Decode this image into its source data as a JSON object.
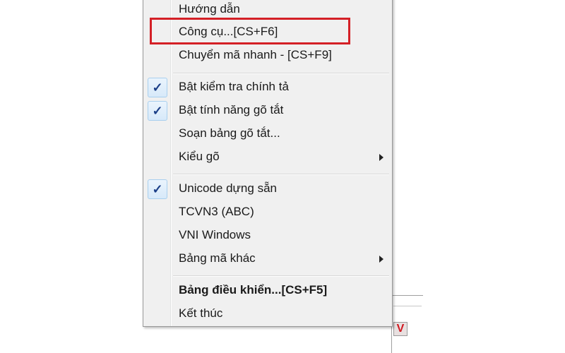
{
  "menu": {
    "items": [
      {
        "label": "Hướng dẫn",
        "checked": false,
        "submenu": false,
        "bold": false
      },
      {
        "label": "Công cụ...[CS+F6]",
        "checked": false,
        "submenu": false,
        "bold": false,
        "highlighted": true
      },
      {
        "label": "Chuyển mã nhanh - [CS+F9]",
        "checked": false,
        "submenu": false,
        "bold": false
      },
      {
        "label": "Bật kiểm tra chính tả",
        "checked": true,
        "submenu": false,
        "bold": false
      },
      {
        "label": "Bật tính năng gõ tắt",
        "checked": true,
        "submenu": false,
        "bold": false
      },
      {
        "label": "Soạn bảng gõ tắt...",
        "checked": false,
        "submenu": false,
        "bold": false
      },
      {
        "label": "Kiểu gõ",
        "checked": false,
        "submenu": true,
        "bold": false
      },
      {
        "label": "Unicode dựng sẵn",
        "checked": true,
        "submenu": false,
        "bold": false
      },
      {
        "label": "TCVN3 (ABC)",
        "checked": false,
        "submenu": false,
        "bold": false
      },
      {
        "label": "VNI Windows",
        "checked": false,
        "submenu": false,
        "bold": false
      },
      {
        "label": "Bảng mã khác",
        "checked": false,
        "submenu": true,
        "bold": false
      },
      {
        "label": "Bảng điều khiển...[CS+F5]",
        "checked": false,
        "submenu": false,
        "bold": true
      },
      {
        "label": "Kết thúc",
        "checked": false,
        "submenu": false,
        "bold": false
      }
    ]
  },
  "icons": {
    "check": "checkmark-icon",
    "submenu": "chevron-right-icon",
    "tray": "vietnamese-keyboard-tray-icon"
  },
  "colors": {
    "highlight_frame": "#d42026",
    "check_mark": "#1c3f88",
    "menu_background": "#f0f0f0"
  },
  "glyphs": {
    "check": "✓",
    "tray": "V"
  }
}
